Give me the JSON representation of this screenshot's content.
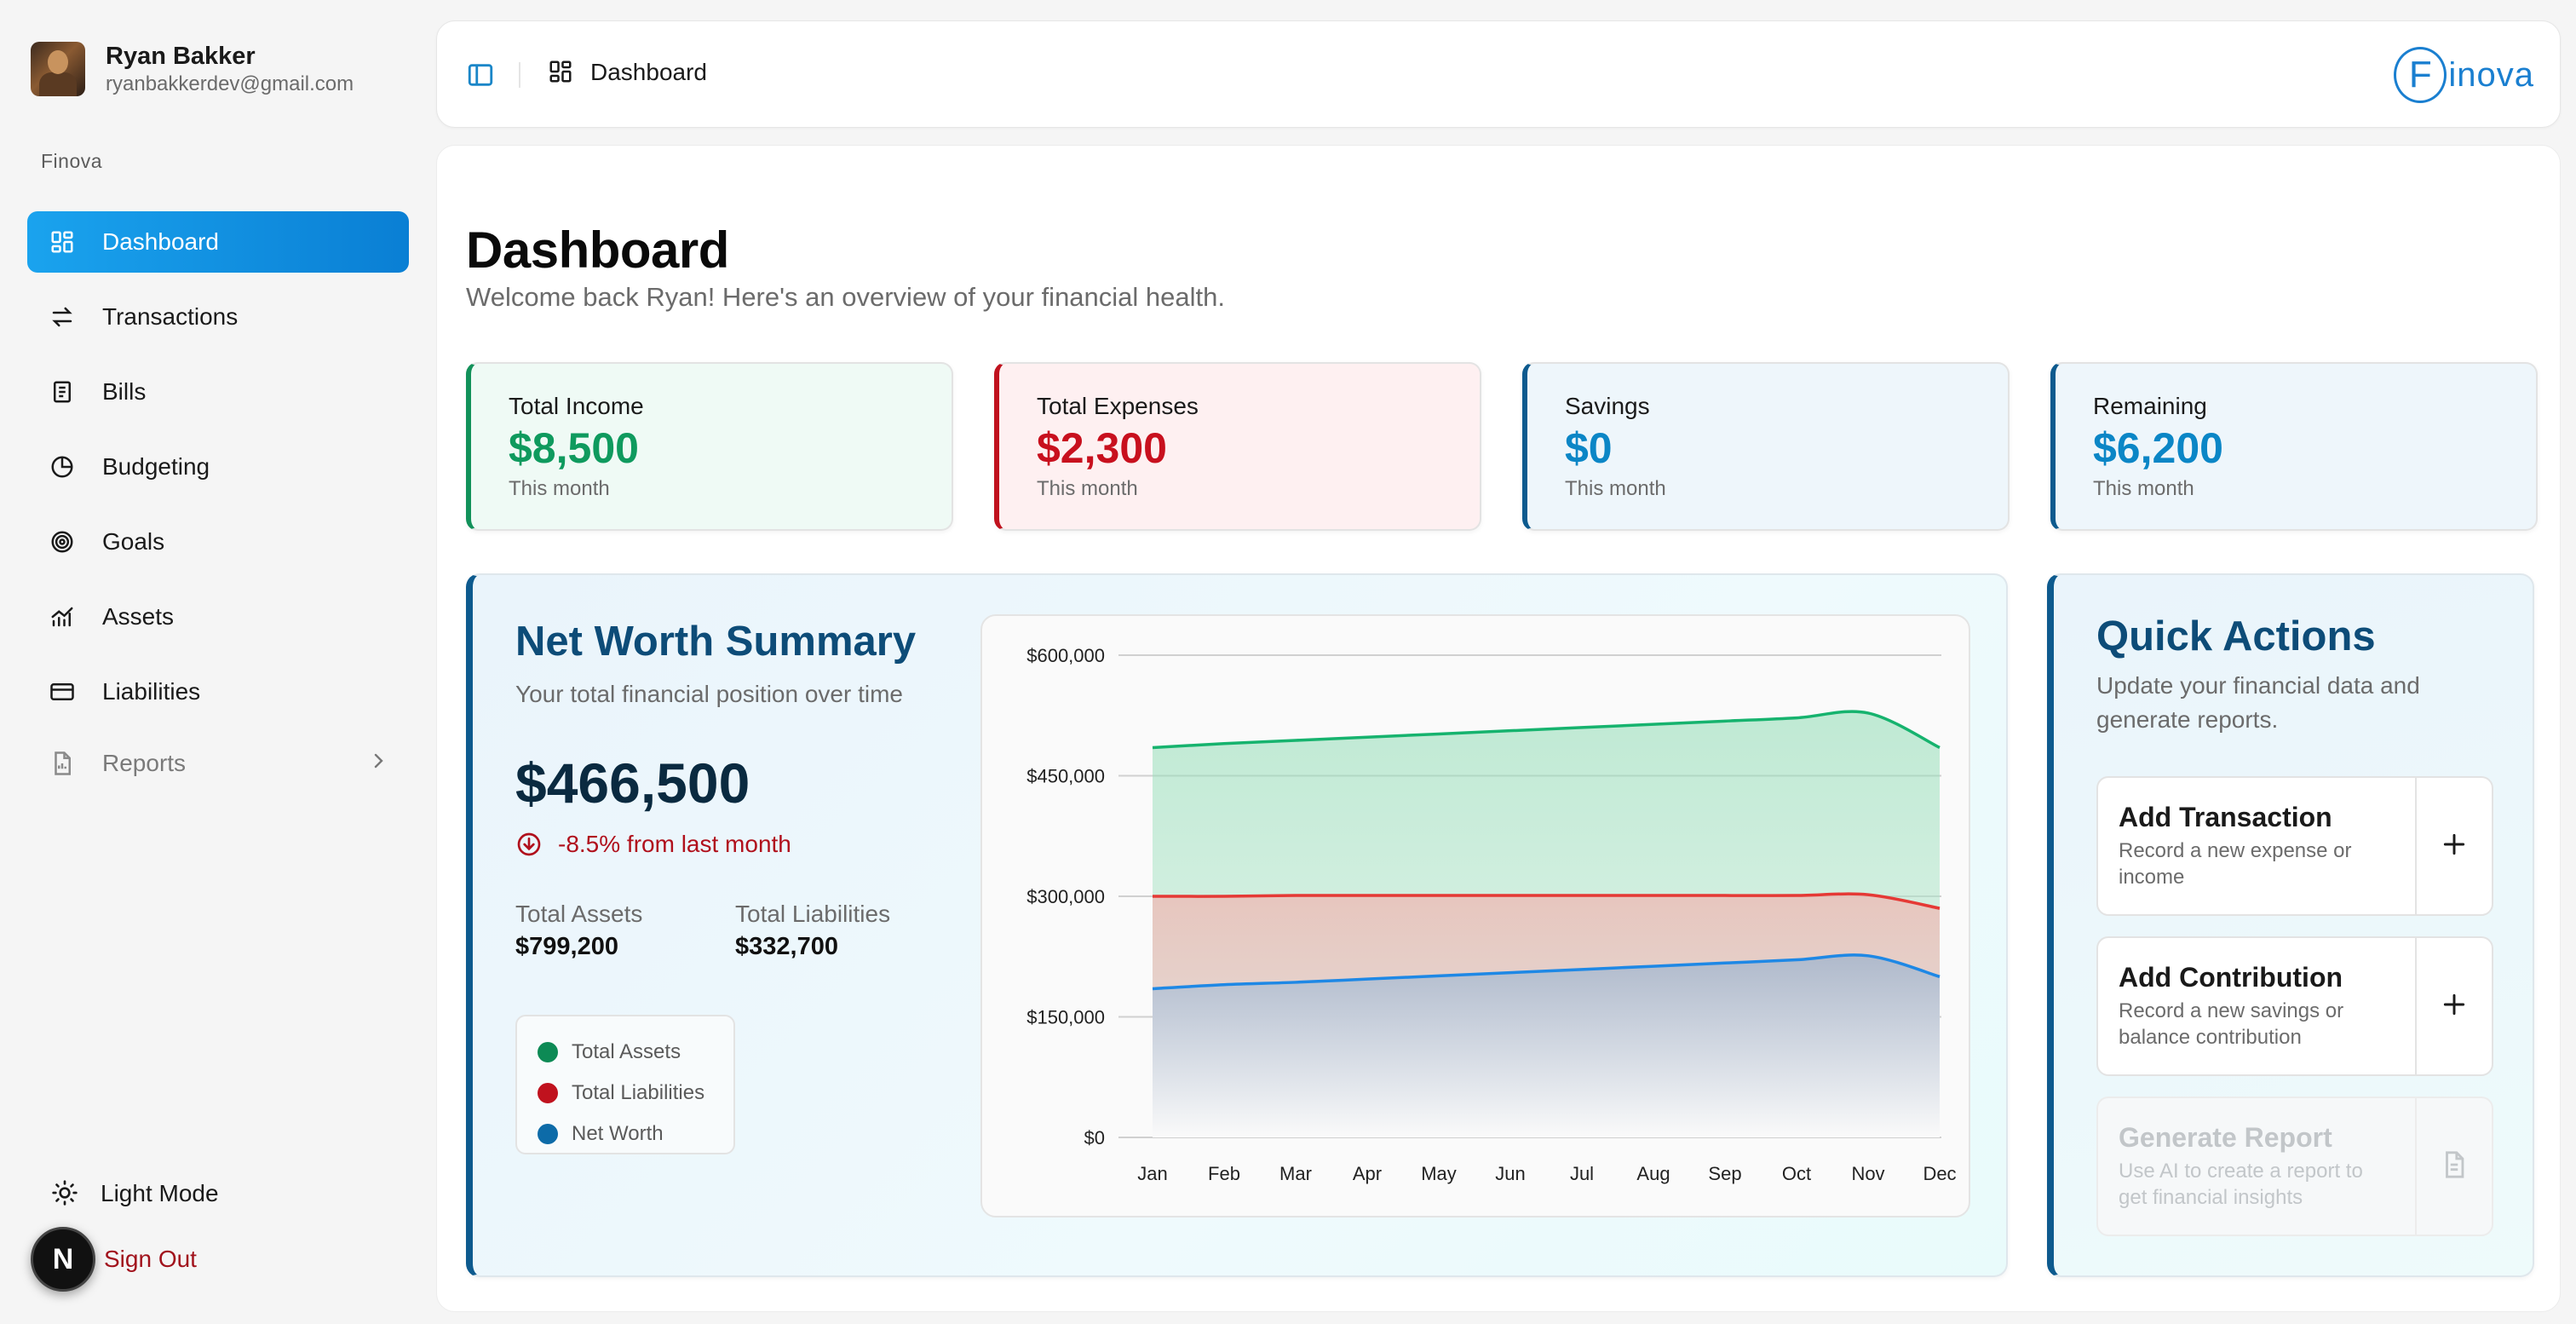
{
  "user": {
    "name": "Ryan Bakker",
    "email": "ryanbakkerdev@gmail.com"
  },
  "sidebar": {
    "section_label": "Finova",
    "items": [
      {
        "label": "Dashboard",
        "icon": "dashboard-icon",
        "active": true
      },
      {
        "label": "Transactions",
        "icon": "arrows-exchange-icon"
      },
      {
        "label": "Bills",
        "icon": "receipt-icon"
      },
      {
        "label": "Budgeting",
        "icon": "pie-chart-icon"
      },
      {
        "label": "Goals",
        "icon": "target-icon"
      },
      {
        "label": "Assets",
        "icon": "bar-chart-icon"
      },
      {
        "label": "Liabilities",
        "icon": "credit-card-icon"
      },
      {
        "label": "Reports",
        "icon": "report-file-icon",
        "muted": true
      }
    ],
    "light_mode_label": "Light Mode",
    "sign_out_label": "Sign Out",
    "badge_letter": "N"
  },
  "header": {
    "breadcrumb": "Dashboard",
    "logo_letter": "F",
    "logo_text": "inova"
  },
  "page": {
    "title": "Dashboard",
    "subtitle": "Welcome back Ryan! Here's an overview of your financial health."
  },
  "stats": [
    {
      "label": "Total Income",
      "value": "$8,500",
      "foot": "This month",
      "color": "#0f9a5e",
      "bg": "#effaf5",
      "border": "#12915a"
    },
    {
      "label": "Total Expenses",
      "value": "$2,300",
      "foot": "This month",
      "color": "#c8101e",
      "bg": "#fef0f1",
      "border": "#c0121e"
    },
    {
      "label": "Savings",
      "value": "$0",
      "foot": "This month",
      "color": "#0b86c6",
      "bg": "#eef6fb",
      "border": "#0d5a8e"
    },
    {
      "label": "Remaining",
      "value": "$6,200",
      "foot": "This month",
      "color": "#0b86c6",
      "bg": "#eef6fb",
      "border": "#0d5a8e"
    }
  ],
  "net_worth": {
    "title": "Net Worth Summary",
    "subtitle": "Your total financial position over time",
    "value": "$466,500",
    "change": "-8.5% from last month",
    "assets_label": "Total Assets",
    "assets_value": "$799,200",
    "liabilities_label": "Total Liabilities",
    "liabilities_value": "$332,700",
    "legend": [
      {
        "label": "Total Assets",
        "color": "#0d8a55"
      },
      {
        "label": "Total Liabilities",
        "color": "#c0121e"
      },
      {
        "label": "Net Worth",
        "color": "#0d6ba8"
      }
    ]
  },
  "chart_data": {
    "type": "area",
    "x": [
      "Jan",
      "Feb",
      "Mar",
      "Apr",
      "May",
      "Jun",
      "Jul",
      "Aug",
      "Sep",
      "Oct",
      "Nov",
      "Dec"
    ],
    "y_ticks": [
      "$0",
      "$150,000",
      "$300,000",
      "$450,000",
      "$600,000"
    ],
    "ylim": [
      0,
      600000
    ],
    "grid": true,
    "series": [
      {
        "name": "Total Assets",
        "color": "#16b36e",
        "values": [
          485000,
          490000,
          494000,
          498000,
          502000,
          506000,
          510000,
          514000,
          518000,
          522000,
          528000,
          485000
        ]
      },
      {
        "name": "Total Liabilities",
        "color": "#e53935",
        "values": [
          300000,
          300000,
          301000,
          301000,
          301000,
          301000,
          301000,
          301000,
          301000,
          301000,
          302000,
          285000
        ]
      },
      {
        "name": "Net Worth",
        "color": "#1e88e5",
        "values": [
          185000,
          190000,
          193000,
          197000,
          201000,
          205000,
          209000,
          213000,
          217000,
          221000,
          226000,
          200000
        ]
      }
    ]
  },
  "quick_actions": {
    "title": "Quick Actions",
    "subtitle": "Update your financial data and generate reports.",
    "items": [
      {
        "name": "Add Transaction",
        "desc": "Record a new expense or income",
        "icon": "plus-icon"
      },
      {
        "name": "Add Contribution",
        "desc": "Record a new savings or balance contribution",
        "icon": "plus-icon"
      },
      {
        "name": "Generate Report",
        "desc": "Use AI to create a report to get financial insights",
        "icon": "document-icon",
        "disabled": true
      }
    ]
  }
}
